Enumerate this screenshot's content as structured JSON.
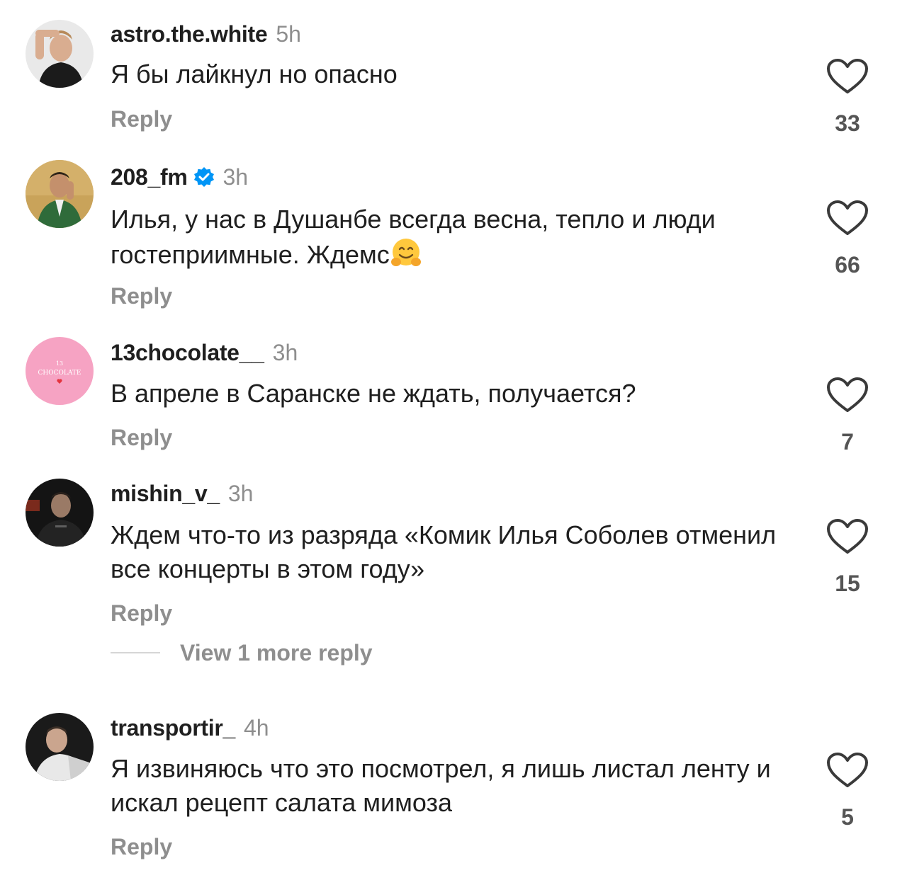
{
  "comments": [
    {
      "username": "astro.the.white",
      "time": "5h",
      "verified": false,
      "text": "Я бы лайкнул но опасно",
      "reply_label": "Reply",
      "likes": "33",
      "avatar": "person-portrait"
    },
    {
      "username": "208_fm",
      "time": "3h",
      "verified": true,
      "text": "Илья, у нас в Душанбе всегда весна, тепло и люди гостеприимные. Ждемс",
      "emoji": "hugging-face",
      "reply_label": "Reply",
      "likes": "66",
      "avatar": "person-portrait"
    },
    {
      "username": "13chocolate__",
      "time": "3h",
      "verified": false,
      "text": "В апреле в Саранске не ждать, получается?",
      "reply_label": "Reply",
      "likes": "7",
      "avatar": "brand-logo",
      "avatar_text": "CHOCOLATE"
    },
    {
      "username": "mishin_v_",
      "time": "3h",
      "verified": false,
      "text": "Ждем что-то из разряда «Комик Илья Соболев отменил все концерты в этом году»",
      "reply_label": "Reply",
      "likes": "15",
      "view_more": "View 1 more reply",
      "avatar": "person-portrait"
    },
    {
      "username": "transportir_",
      "time": "4h",
      "verified": false,
      "text": "Я извиняюсь что это посмотрел, я лишь листал ленту и искал рецепт салата мимоза",
      "reply_label": "Reply",
      "likes": "5",
      "avatar": "person-portrait"
    }
  ],
  "colors": {
    "text": "#1f1f1f",
    "muted": "#8e8e8e",
    "verified": "#0095f6",
    "avatar_pink": "#f6a3c3"
  }
}
